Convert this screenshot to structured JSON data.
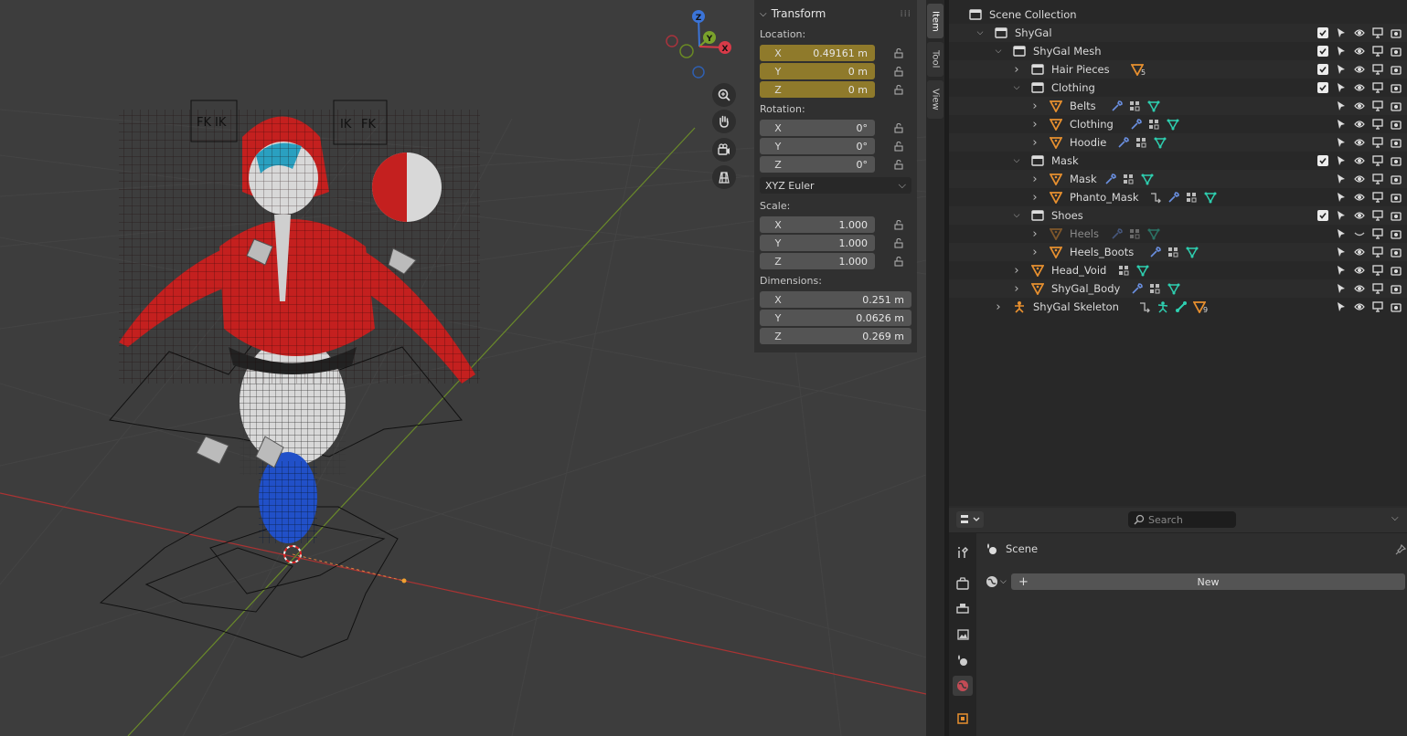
{
  "npanel": {
    "title": "Transform",
    "location_label": "Location:",
    "location": [
      {
        "axis": "X",
        "value": "0.49161 m"
      },
      {
        "axis": "Y",
        "value": "0 m"
      },
      {
        "axis": "Z",
        "value": "0 m"
      }
    ],
    "rotation_label": "Rotation:",
    "rotation": [
      {
        "axis": "X",
        "value": "0°"
      },
      {
        "axis": "Y",
        "value": "0°"
      },
      {
        "axis": "Z",
        "value": "0°"
      }
    ],
    "rotation_mode": "XYZ Euler",
    "scale_label": "Scale:",
    "scale": [
      {
        "axis": "X",
        "value": "1.000"
      },
      {
        "axis": "Y",
        "value": "1.000"
      },
      {
        "axis": "Z",
        "value": "1.000"
      }
    ],
    "dimensions_label": "Dimensions:",
    "dimensions": [
      {
        "axis": "X",
        "value": "0.251 m"
      },
      {
        "axis": "Y",
        "value": "0.0626 m"
      },
      {
        "axis": "Z",
        "value": "0.269 m"
      }
    ]
  },
  "sidetabs": [
    "Item",
    "Tool",
    "View"
  ],
  "viewport": {
    "gizmo": {
      "z": "Z",
      "y": "Y",
      "x": "X"
    },
    "rig_labels": [
      "FK",
      "IK",
      "IK",
      "FK"
    ]
  },
  "outliner": {
    "rows": [
      {
        "name": "Scene Collection",
        "icon": "collection-icon",
        "extras": []
      },
      {
        "name": "ShyGal",
        "icon": "collection-icon",
        "extras": []
      },
      {
        "name": "ShyGal Mesh",
        "icon": "collection-icon",
        "extras": []
      },
      {
        "name": "Hair Pieces",
        "icon": "collection-icon",
        "extras": [
          "mesh-icon"
        ],
        "badge": "5"
      },
      {
        "name": "Clothing",
        "icon": "collection-icon",
        "extras": []
      },
      {
        "name": "Belts",
        "icon": "mesh-object-icon",
        "extras": [
          "wrench-icon",
          "vertex-groups-icon",
          "mesh-data-icon"
        ]
      },
      {
        "name": "Clothing",
        "icon": "mesh-object-icon",
        "extras": [
          "wrench-icon",
          "vertex-groups-icon",
          "mesh-data-icon"
        ]
      },
      {
        "name": "Hoodie",
        "icon": "mesh-object-icon",
        "extras": [
          "wrench-icon",
          "vertex-groups-icon",
          "mesh-data-icon"
        ]
      },
      {
        "name": "Mask",
        "icon": "collection-icon",
        "extras": []
      },
      {
        "name": "Mask",
        "icon": "mesh-object-icon",
        "extras": [
          "wrench-icon",
          "vertex-groups-icon",
          "mesh-data-icon"
        ]
      },
      {
        "name": "Phanto_Mask",
        "icon": "mesh-object-icon",
        "extras": [
          "parent-icon",
          "wrench-icon",
          "vertex-groups-icon",
          "mesh-data-icon"
        ]
      },
      {
        "name": "Shoes",
        "icon": "collection-icon",
        "extras": []
      },
      {
        "name": "Heels",
        "icon": "mesh-object-icon",
        "extras": [
          "wrench-icon",
          "vertex-groups-icon",
          "mesh-data-icon"
        ],
        "dim": true
      },
      {
        "name": "Heels_Boots",
        "icon": "mesh-object-icon",
        "extras": [
          "wrench-icon",
          "vertex-groups-icon",
          "mesh-data-icon"
        ]
      },
      {
        "name": "Head_Void",
        "icon": "mesh-object-icon",
        "extras": [
          "vertex-groups-icon",
          "mesh-data-icon"
        ]
      },
      {
        "name": "ShyGal_Body",
        "icon": "mesh-object-icon",
        "extras": [
          "wrench-icon",
          "vertex-groups-icon",
          "mesh-data-icon"
        ]
      },
      {
        "name": "ShyGal Skeleton",
        "icon": "armature-icon",
        "extras": [
          "parent-icon",
          "pose-icon",
          "bone-icon",
          "mesh-icon"
        ],
        "badge": "9"
      }
    ]
  },
  "properties": {
    "search_placeholder": "Search",
    "scene_label": "Scene",
    "new_button": "New"
  }
}
